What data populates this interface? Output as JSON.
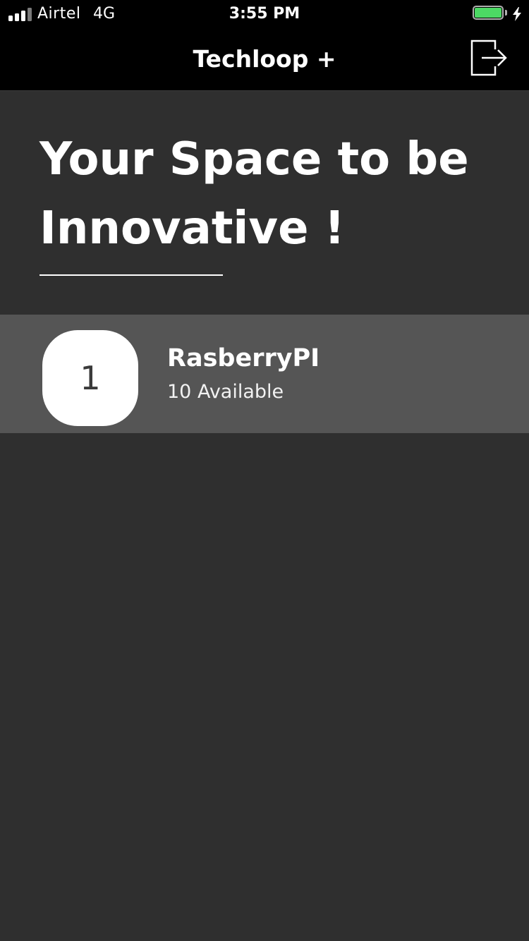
{
  "status_bar": {
    "carrier": "Airtel",
    "network": "4G",
    "time": "3:55 PM",
    "signal_bars_filled": 3,
    "signal_bars_total": 4,
    "battery_level": 1.0,
    "battery_color": "#4cd964",
    "charging": true
  },
  "nav": {
    "title": "Techloop +",
    "logout_icon": "logout-icon"
  },
  "hero": {
    "title": "Your Space to be Innovative !"
  },
  "items": [
    {
      "badge": "1",
      "name": "RasberryPI",
      "status": "10 Available"
    }
  ],
  "colors": {
    "background": "#2f2f2f",
    "nav_background": "#000000",
    "list_item_background": "#555555",
    "text": "#ffffff"
  }
}
